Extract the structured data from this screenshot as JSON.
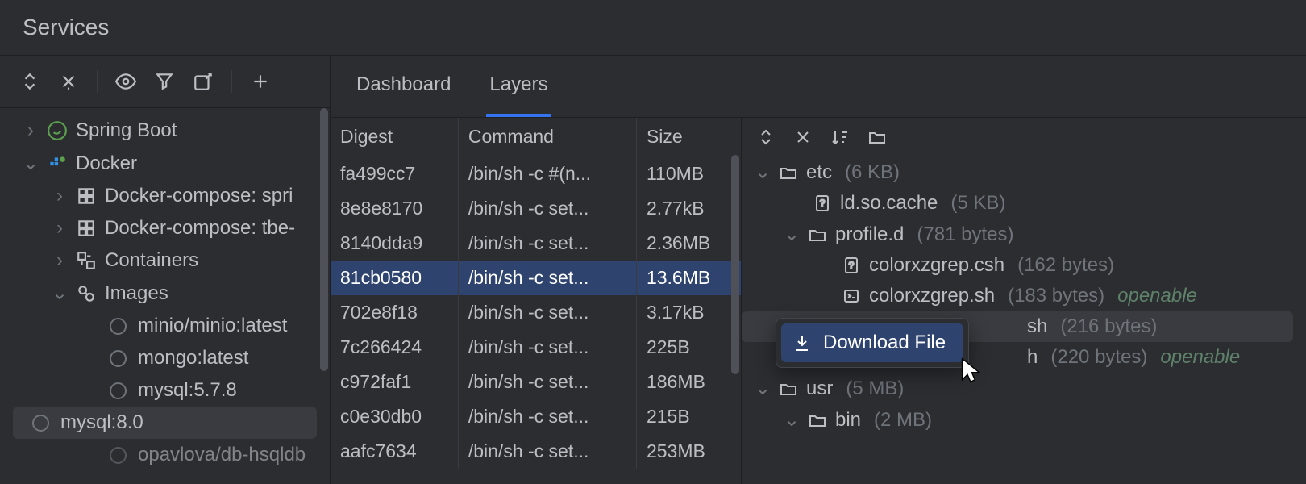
{
  "title": "Services",
  "tabs": {
    "dashboard": "Dashboard",
    "layers": "Layers"
  },
  "tree": {
    "spring_boot": "Spring Boot",
    "docker": "Docker",
    "compose1": "Docker-compose: spri",
    "compose2": "Docker-compose: tbe-",
    "containers": "Containers",
    "images": "Images",
    "img0": "minio/minio:latest",
    "img1": "mongo:latest",
    "img2": "mysql:5.7.8",
    "img3": "mysql:8.0",
    "img4": "opavlova/db-hsqldb"
  },
  "table": {
    "headers": {
      "digest": "Digest",
      "command": "Command",
      "size": "Size"
    },
    "rows": [
      {
        "digest": "fa499cc7",
        "command": "/bin/sh -c #(n...",
        "size": "110MB"
      },
      {
        "digest": "8e8e8170",
        "command": "/bin/sh -c set...",
        "size": "2.77kB"
      },
      {
        "digest": "8140dda9",
        "command": "/bin/sh -c set...",
        "size": "2.36MB"
      },
      {
        "digest": "81cb0580",
        "command": "/bin/sh -c set...",
        "size": "13.6MB"
      },
      {
        "digest": "702e8f18",
        "command": "/bin/sh -c set...",
        "size": "3.17kB"
      },
      {
        "digest": "7c266424",
        "command": "/bin/sh -c set...",
        "size": "225B"
      },
      {
        "digest": "c972faf1",
        "command": "/bin/sh -c set...",
        "size": "186MB"
      },
      {
        "digest": "c0e30db0",
        "command": "/bin/sh -c set...",
        "size": "215B"
      },
      {
        "digest": "aafc7634",
        "command": "/bin/sh -c set...",
        "size": "253MB"
      }
    ],
    "selected_index": 3
  },
  "filetree": {
    "etc": {
      "name": "etc",
      "size": "(6 KB)"
    },
    "ld_so_cache": {
      "name": "ld.so.cache",
      "size": "(5 KB)"
    },
    "profile_d": {
      "name": "profile.d",
      "size": "(781 bytes)"
    },
    "csh": {
      "name": "colorxzgrep.csh",
      "size": "(162 bytes)"
    },
    "sh": {
      "name": "colorxzgrep.sh",
      "size": "(183 bytes)",
      "openable": "openable"
    },
    "hidden1": {
      "name": "sh",
      "size": "(216 bytes)"
    },
    "hidden2": {
      "name": "h",
      "size": "(220 bytes)",
      "openable": "openable"
    },
    "usr": {
      "name": "usr",
      "size": "(5 MB)"
    },
    "bin": {
      "name": "bin",
      "size": "(2 MB)"
    }
  },
  "context_menu": {
    "download": "Download File"
  }
}
